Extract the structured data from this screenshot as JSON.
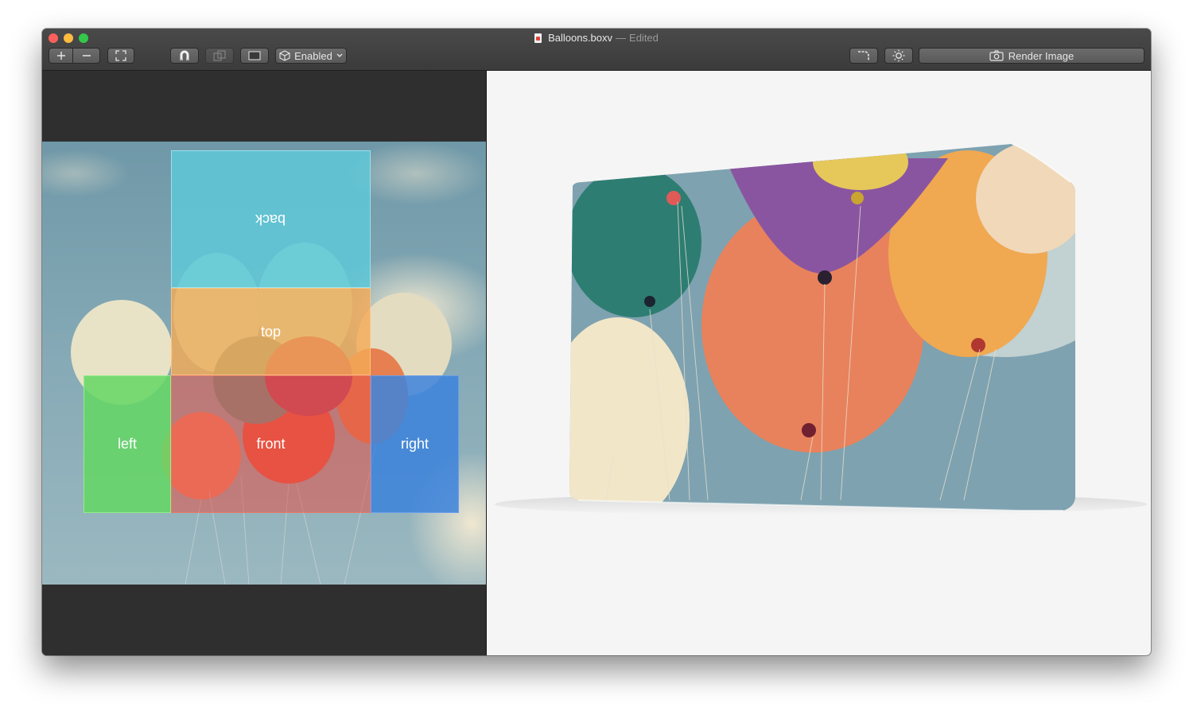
{
  "window": {
    "file_name": "Balloons.boxv",
    "status": "Edited",
    "title_separator": "—"
  },
  "toolbar": {
    "add_icon": "plus-icon",
    "remove_icon": "minus-icon",
    "fit_icon": "expand-icon",
    "snap_icon": "magnet-icon",
    "layer_icon": "layer-icon",
    "preview_icon": "rectangle-icon",
    "mode_label": "Enabled",
    "mode_icon": "cube-icon",
    "corner_icon": "rounded-corner-icon",
    "light_icon": "sun-icon",
    "render_label": "Render Image",
    "render_icon": "camera-icon"
  },
  "faces": {
    "back": "back",
    "top": "top",
    "left": "left",
    "front": "front",
    "right": "right"
  },
  "colors": {
    "back": "#5fc8d7",
    "top": "#f5aa55",
    "left": "#64d764",
    "front": "#e65046",
    "right": "#3c82dc",
    "sky": "#7fa3b1"
  }
}
